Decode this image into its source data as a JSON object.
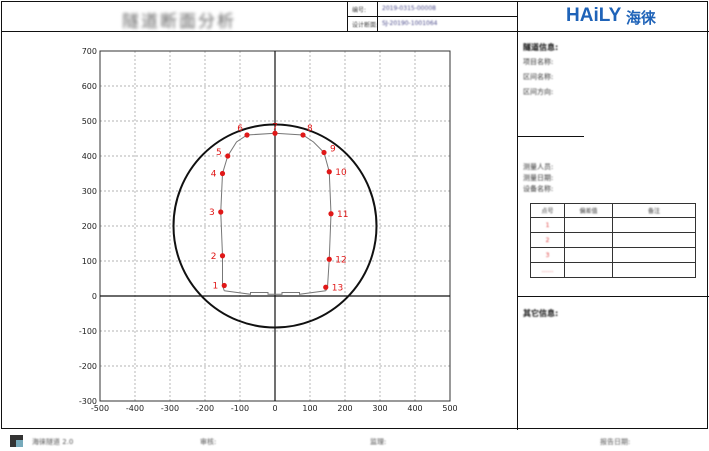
{
  "header": {
    "title": "隧道断面分析",
    "fields": [
      {
        "label": "编号:",
        "value": "2019-0315-00008"
      },
      {
        "label": "设计断面:",
        "value": "SJ-20190-1001064"
      }
    ]
  },
  "logo": {
    "brand": "HAiLY",
    "brand_cn": "海徕"
  },
  "right_panel": {
    "heading_1": "隧道信息:",
    "info_labels": [
      "项目名称:",
      "区间名称:",
      "区间方向:"
    ],
    "measure_labels": [
      "测量人员:",
      "测量日期:",
      "设备名称:"
    ],
    "table": {
      "headers": [
        "点号",
        "偏差值",
        "备注"
      ],
      "rows": [
        [
          "1",
          "",
          ""
        ],
        [
          "2",
          "",
          ""
        ],
        [
          "3",
          "",
          ""
        ],
        [
          "……",
          "",
          ""
        ]
      ]
    },
    "heading_2": "其它信息:"
  },
  "footer": {
    "app_name": "海徕隧道 2.0",
    "reviewer": "审核:",
    "supervisor": "监理:",
    "report_date": "报告日期:"
  },
  "chart_data": {
    "type": "scatter",
    "xlim": [
      -500,
      500
    ],
    "ylim": [
      -300,
      700
    ],
    "x_ticks": [
      -500,
      -400,
      -300,
      -200,
      -100,
      0,
      100,
      200,
      300,
      400,
      500
    ],
    "y_ticks": [
      -300,
      -200,
      -100,
      0,
      100,
      200,
      300,
      400,
      500,
      600,
      700
    ],
    "grid": true,
    "circle": {
      "cx": 0,
      "cy": 200,
      "r": 290
    },
    "points": [
      {
        "label": "1",
        "x": -145,
        "y": 30
      },
      {
        "label": "2",
        "x": -150,
        "y": 115
      },
      {
        "label": "3",
        "x": -155,
        "y": 240
      },
      {
        "label": "4",
        "x": -150,
        "y": 350
      },
      {
        "label": "5",
        "x": -135,
        "y": 400
      },
      {
        "label": "6",
        "x": -80,
        "y": 460
      },
      {
        "label": "7",
        "x": 0,
        "y": 465
      },
      {
        "label": "8",
        "x": 80,
        "y": 460
      },
      {
        "label": "9",
        "x": 140,
        "y": 410
      },
      {
        "label": "10",
        "x": 155,
        "y": 355
      },
      {
        "label": "11",
        "x": 160,
        "y": 235
      },
      {
        "label": "12",
        "x": 155,
        "y": 105
      },
      {
        "label": "13",
        "x": 145,
        "y": 25
      }
    ],
    "profile": [
      [
        -145,
        15
      ],
      [
        -150,
        30
      ],
      [
        -150,
        115
      ],
      [
        -155,
        240
      ],
      [
        -150,
        350
      ],
      [
        -135,
        400
      ],
      [
        -110,
        440
      ],
      [
        -80,
        460
      ],
      [
        0,
        465
      ],
      [
        80,
        460
      ],
      [
        110,
        440
      ],
      [
        140,
        410
      ],
      [
        155,
        355
      ],
      [
        160,
        235
      ],
      [
        155,
        105
      ],
      [
        150,
        25
      ],
      [
        145,
        15
      ]
    ],
    "track_bed": [
      [
        -145,
        15
      ],
      [
        -70,
        5
      ],
      [
        -70,
        10
      ],
      [
        -20,
        10
      ],
      [
        -20,
        5
      ],
      [
        20,
        5
      ],
      [
        20,
        10
      ],
      [
        70,
        10
      ],
      [
        70,
        5
      ],
      [
        145,
        15
      ]
    ],
    "colors": {
      "points": "#e01818",
      "circle": "#111111",
      "profile": "#777777",
      "grid": "#9a9a9a"
    }
  }
}
